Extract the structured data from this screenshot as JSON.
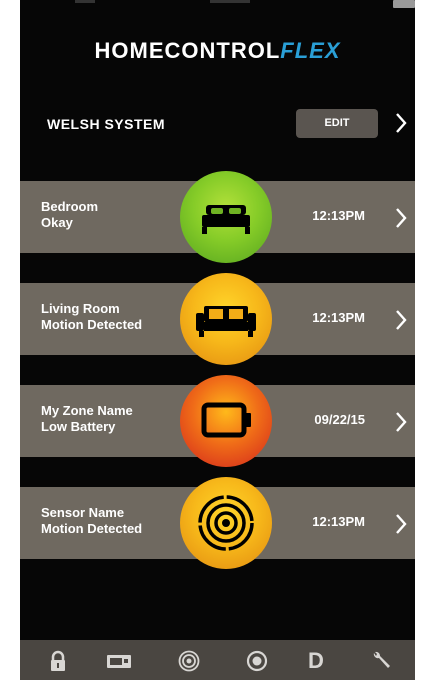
{
  "app": {
    "title_main": "HOMECONTROL",
    "title_accent": "FLEX"
  },
  "system": {
    "name": "WELSH SYSTEM",
    "edit_label": "EDIT"
  },
  "zones": [
    {
      "name": "Bedroom",
      "status": "Okay",
      "time": "12:13PM",
      "icon": "bed-icon",
      "color": "#86cc28"
    },
    {
      "name": "Living Room",
      "status": "Motion Detected",
      "time": "12:13PM",
      "icon": "sofa-icon",
      "color": "#f7b81a"
    },
    {
      "name": "My Zone Name",
      "status": "Low Battery",
      "time": "09/22/15",
      "icon": "battery-icon",
      "color": "#e5501a"
    },
    {
      "name": "Sensor Name",
      "status": "Motion Detected",
      "time": "12:13PM",
      "icon": "target-icon",
      "color": "#f7b81a"
    }
  ],
  "tabs": [
    {
      "icon": "lock-icon"
    },
    {
      "icon": "camera-icon"
    },
    {
      "icon": "sensor-icon"
    },
    {
      "icon": "clock-icon"
    },
    {
      "icon": "d-logo-icon",
      "label": "D"
    },
    {
      "icon": "wrench-icon"
    }
  ]
}
